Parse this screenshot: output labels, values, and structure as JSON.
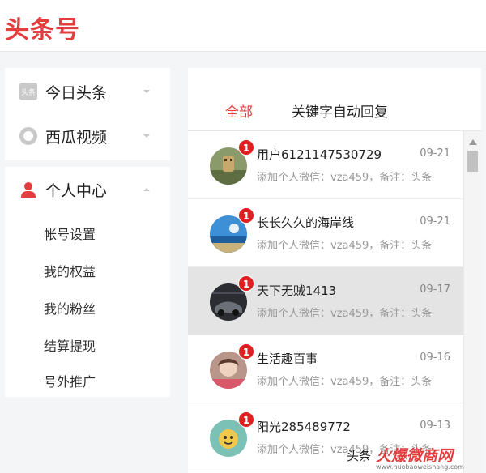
{
  "app": {
    "logo": "头条号"
  },
  "sidebar": {
    "top_items": [
      {
        "label": "今日头条",
        "icon": "toutiao-icon",
        "icon_text": "头条"
      },
      {
        "label": "西瓜视频",
        "icon": "xigua-icon"
      }
    ],
    "personal": {
      "label": "个人中心",
      "icon": "person-icon",
      "sub_items": [
        "帐号设置",
        "我的权益",
        "我的粉丝",
        "结算提现",
        "号外推广"
      ]
    }
  },
  "tabs": [
    {
      "label": "全部",
      "active": true
    },
    {
      "label": "关键字自动回复",
      "active": false
    }
  ],
  "messages": [
    {
      "name": "用户6121147530729",
      "date": "09-21",
      "preview": "添加个人微信：vza459，备注：头条",
      "badge": "1",
      "selected": false
    },
    {
      "name": "长长久久的海岸线",
      "date": "09-21",
      "preview": "添加个人微信：vza459，备注：头条",
      "badge": "1",
      "selected": false
    },
    {
      "name": "天下无贼1413",
      "date": "09-17",
      "preview": "添加个人微信：vza459，备注：头条",
      "badge": "1",
      "selected": true
    },
    {
      "name": "生活趣百事",
      "date": "09-16",
      "preview": "添加个人微信：vza459，备注：头条",
      "badge": "1",
      "selected": false
    },
    {
      "name": "阳光285489772",
      "date": "09-13",
      "preview": "添加个人微信：vza459，备注：头条",
      "badge": "1",
      "selected": false
    }
  ],
  "watermark": {
    "text": "头条",
    "brand": "火爆微商网",
    "sub": "www.huobaoweishang.com"
  },
  "colors": {
    "accent": "#e33e3e",
    "badge": "#e02020",
    "selected_row": "#e4e4e4"
  }
}
